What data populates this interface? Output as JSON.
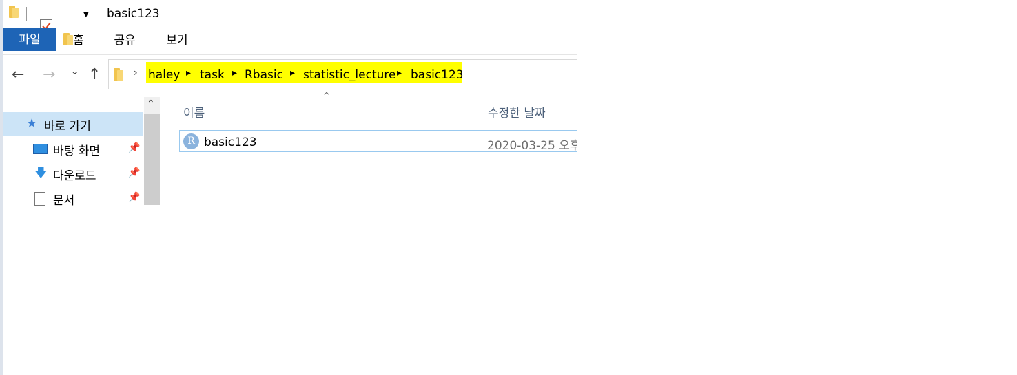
{
  "window": {
    "title": "basic123"
  },
  "ribbon": {
    "tabs": [
      "파일",
      "홈",
      "공유",
      "보기"
    ]
  },
  "address": {
    "path": [
      "haley",
      "task",
      "Rbasic",
      "statistic_lecture",
      "basic123"
    ],
    "highlight_color": "#ffff00"
  },
  "nav": {
    "back_icon": "←",
    "forward_icon": "→",
    "recent_icon": "⌄",
    "up_icon": "↑"
  },
  "sidebar": {
    "quick_access": "바로 가기",
    "items": [
      {
        "label": "바탕 화면",
        "icon": "desktop-icon"
      },
      {
        "label": "다운로드",
        "icon": "download-icon"
      },
      {
        "label": "문서",
        "icon": "document-icon"
      }
    ]
  },
  "columns": {
    "name": "이름",
    "date": "수정한 날짜"
  },
  "files": [
    {
      "name": "basic123",
      "date": "2020-03-25 오후",
      "icon": "r-file-icon",
      "icon_letter": "R"
    }
  ],
  "colors": {
    "accent": "#1e64b6",
    "selection": "#cce4f7"
  }
}
